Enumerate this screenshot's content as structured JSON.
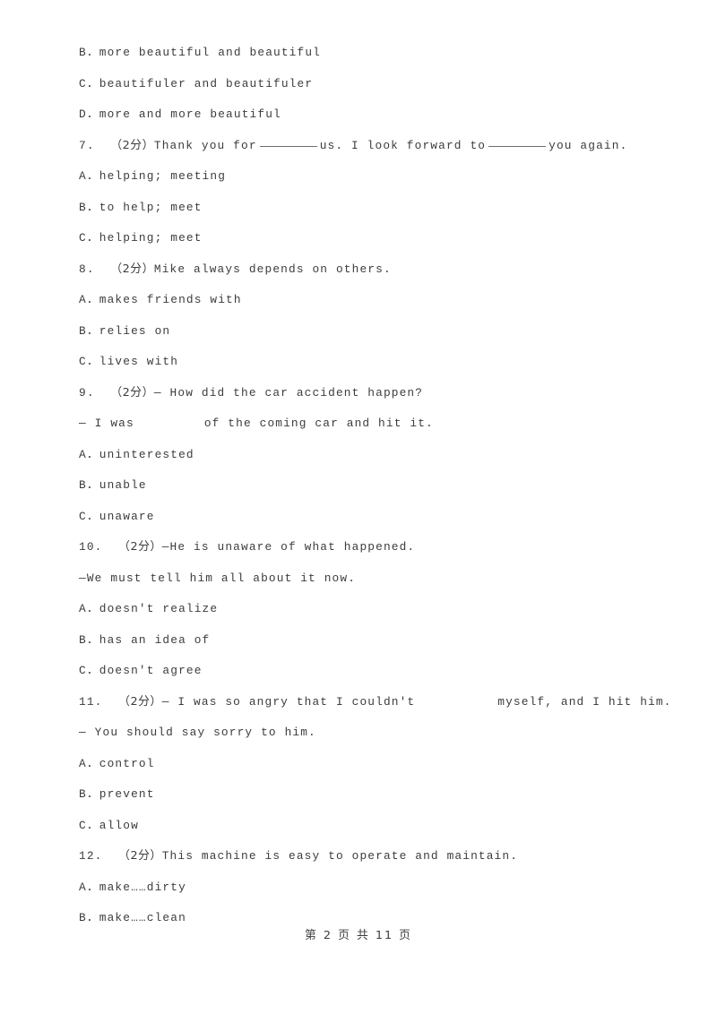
{
  "document": {
    "type": "exam-worksheet",
    "language": "en-with-zh-annotations",
    "text_color": "#3c3c3c",
    "background_color": "#ffffff"
  },
  "lines": [
    {
      "id": "l0",
      "kind": "option",
      "text": "B．more beautiful and beautiful"
    },
    {
      "id": "l1",
      "kind": "option",
      "text": "C．beautifuler and beautifuler"
    },
    {
      "id": "l2",
      "kind": "option",
      "text": "D．more and more beautiful"
    },
    {
      "id": "l3",
      "kind": "question",
      "number": "7.",
      "marks": "（2分）",
      "pre": "Thank you for",
      "mid": "us.  I look forward to",
      "post": "you again.",
      "blanks": 2
    },
    {
      "id": "l4",
      "kind": "option",
      "text": "A．helping; meeting"
    },
    {
      "id": "l5",
      "kind": "option",
      "text": "B．to help; meet"
    },
    {
      "id": "l6",
      "kind": "option",
      "text": "C．helping; meet"
    },
    {
      "id": "l7",
      "kind": "question",
      "number": "8.",
      "marks": "（2分）",
      "text": "Mike always depends on others."
    },
    {
      "id": "l8",
      "kind": "option",
      "text": "A．makes friends with"
    },
    {
      "id": "l9",
      "kind": "option",
      "text": "B．relies on"
    },
    {
      "id": "l10",
      "kind": "option",
      "text": "C．lives with"
    },
    {
      "id": "l11",
      "kind": "question",
      "number": "9.",
      "marks": "（2分）",
      "text": "— How did the car accident happen?"
    },
    {
      "id": "l12",
      "kind": "continuation",
      "pre": "— I was",
      "post": "of the coming car and hit it.",
      "gap": true
    },
    {
      "id": "l13",
      "kind": "option",
      "text": "A．uninterested"
    },
    {
      "id": "l14",
      "kind": "option",
      "text": "B．unable"
    },
    {
      "id": "l15",
      "kind": "option",
      "text": "C．unaware"
    },
    {
      "id": "l16",
      "kind": "question",
      "number": "10.",
      "marks": "（2分）",
      "text": "—He is unaware of what happened."
    },
    {
      "id": "l17",
      "kind": "continuation",
      "text": "—We must tell him all about it now."
    },
    {
      "id": "l18",
      "kind": "option",
      "text": "A．doesn't realize"
    },
    {
      "id": "l19",
      "kind": "option",
      "text": "B．has an idea of"
    },
    {
      "id": "l20",
      "kind": "option",
      "text": "C．doesn't agree"
    },
    {
      "id": "l21",
      "kind": "question",
      "number": "11.",
      "marks": "（2分）",
      "pre": "— I was so angry that I couldn't",
      "post": "myself, and I hit him.",
      "gap": true
    },
    {
      "id": "l22",
      "kind": "continuation",
      "text": "— You should say sorry to him."
    },
    {
      "id": "l23",
      "kind": "option",
      "text": "A．control"
    },
    {
      "id": "l24",
      "kind": "option",
      "text": "B．prevent"
    },
    {
      "id": "l25",
      "kind": "option",
      "text": "C．allow"
    },
    {
      "id": "l26",
      "kind": "question",
      "number": "12.",
      "marks": "（2分）",
      "text": "This machine is easy to operate and maintain."
    },
    {
      "id": "l27",
      "kind": "option",
      "text": "A．make……dirty"
    },
    {
      "id": "l28",
      "kind": "option",
      "text": "B．make……clean"
    }
  ],
  "footer": {
    "page_label": "第 2 页 共 11 页",
    "current_page": "2",
    "total_pages": "11"
  }
}
